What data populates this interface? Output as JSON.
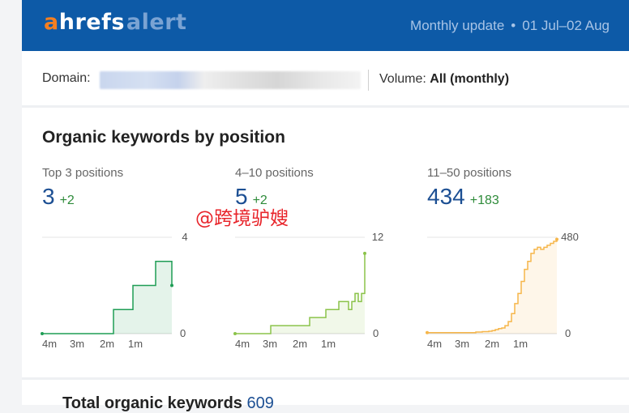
{
  "header": {
    "logo_a": "a",
    "logo_hrefs": "hrefs",
    "logo_alert": "alert",
    "update_label": "Monthly update",
    "separator": "•",
    "date_range": "01 Jul–02 Aug"
  },
  "filters": {
    "domain_label": "Domain:",
    "volume_label": "Volume:",
    "volume_value": "All (monthly)"
  },
  "section": {
    "title": "Organic keywords by position"
  },
  "columns": [
    {
      "label": "Top 3 positions",
      "value": "3",
      "delta": "+2",
      "ymax": "4",
      "ymin": "0",
      "x_ticks": [
        "4m",
        "3m",
        "2m",
        "1m"
      ]
    },
    {
      "label": "4–10 positions",
      "value": "5",
      "delta": "+2",
      "ymax": "12",
      "ymin": "0",
      "x_ticks": [
        "4m",
        "3m",
        "2m",
        "1m"
      ]
    },
    {
      "label": "11–50 positions",
      "value": "434",
      "delta": "+183",
      "ymax": "480",
      "ymin": "0",
      "x_ticks": [
        "4m",
        "3m",
        "2m",
        "1m"
      ]
    }
  ],
  "chart_data": [
    {
      "type": "area",
      "title": "Top 3 positions",
      "ylim": [
        0,
        4
      ],
      "x_ticks": [
        "4m",
        "3m",
        "2m",
        "1m"
      ],
      "series": [
        {
          "values": [
            0,
            0,
            0,
            0,
            0,
            0,
            0,
            0,
            0,
            0,
            0,
            0,
            0,
            0,
            0,
            0,
            0,
            0,
            0,
            0,
            0,
            0,
            1,
            1,
            1,
            1,
            1,
            1,
            2,
            2,
            2,
            2,
            2,
            2,
            2,
            3,
            3,
            3,
            3,
            3,
            2
          ]
        }
      ],
      "color": "#1f9d55"
    },
    {
      "type": "area",
      "title": "4–10 positions",
      "ylim": [
        0,
        12
      ],
      "x_ticks": [
        "4m",
        "3m",
        "2m",
        "1m"
      ],
      "series": [
        {
          "values": [
            0,
            0,
            0,
            0,
            0,
            0,
            0,
            0,
            0,
            0,
            0,
            1,
            1,
            1,
            1,
            1,
            1,
            1,
            1,
            1,
            1,
            1,
            1,
            2,
            2,
            2,
            2,
            2,
            3,
            3,
            3,
            3,
            4,
            4,
            4,
            3,
            4,
            5,
            4,
            5,
            10
          ]
        }
      ],
      "color": "#8bc34a"
    },
    {
      "type": "area",
      "title": "11–50 positions",
      "ylim": [
        0,
        480
      ],
      "x_ticks": [
        "4m",
        "3m",
        "2m",
        "1m"
      ],
      "series": [
        {
          "values": [
            5,
            5,
            5,
            5,
            5,
            5,
            5,
            5,
            5,
            5,
            5,
            5,
            5,
            5,
            5,
            8,
            8,
            10,
            10,
            12,
            15,
            20,
            25,
            28,
            40,
            60,
            100,
            150,
            200,
            260,
            320,
            360,
            400,
            420,
            430,
            420,
            430,
            440,
            450,
            460,
            470
          ]
        }
      ],
      "color": "#f6b64a"
    }
  ],
  "watermark": "@跨境驴嫂",
  "bottom": {
    "title": "Total organic keywords",
    "value": "609"
  },
  "colors": {
    "header_bg": "#0d5aa7",
    "accent_blue": "#1c4f93",
    "positive": "#2e8b3a"
  }
}
